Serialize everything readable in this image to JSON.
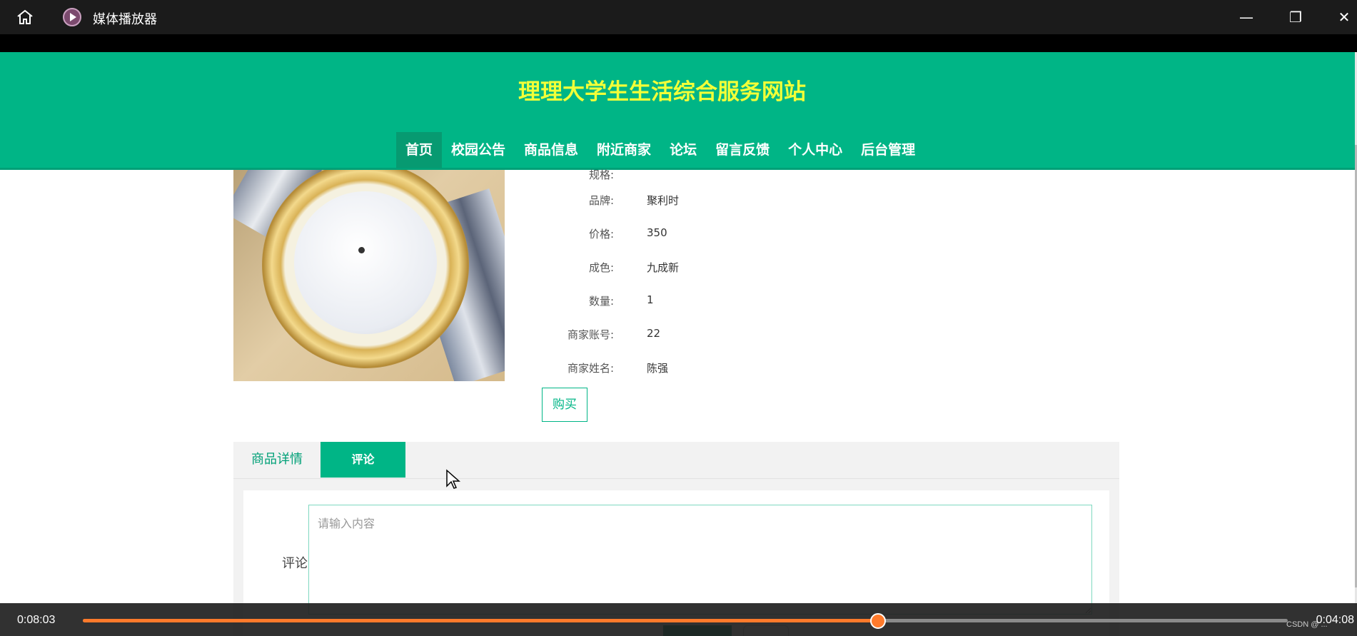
{
  "window": {
    "title": "媒体播放器",
    "icons": {
      "home": "home-icon",
      "app": "media-player-icon",
      "minimize": "minimize-icon",
      "maximize": "restore-icon",
      "close": "close-icon"
    }
  },
  "site": {
    "title": "理理大学生生活综合服务网站",
    "colors": {
      "header": "#00b586",
      "title": "#f2ff38",
      "active_nav": "#079a71"
    },
    "nav": [
      {
        "label": "首页",
        "active": true
      },
      {
        "label": "校园公告"
      },
      {
        "label": "商品信息"
      },
      {
        "label": "附近商家"
      },
      {
        "label": "论坛"
      },
      {
        "label": "留言反馈"
      },
      {
        "label": "个人中心"
      },
      {
        "label": "后台管理"
      }
    ]
  },
  "product": {
    "specs": [
      {
        "label": "规格:",
        "value": ""
      },
      {
        "label": "品牌:",
        "value": "聚利时"
      },
      {
        "label": "价格:",
        "value": "350"
      },
      {
        "label": "成色:",
        "value": "九成新"
      },
      {
        "label": "数量:",
        "value": "1"
      },
      {
        "label": "商家账号:",
        "value": "22"
      },
      {
        "label": "商家姓名:",
        "value": "陈强"
      }
    ],
    "buy_label": "购买"
  },
  "tabs": [
    {
      "label": "商品详情"
    },
    {
      "label": "评论",
      "active": true
    }
  ],
  "comment": {
    "label": "评论",
    "placeholder": "请输入内容"
  },
  "player": {
    "current_time": "0:08:03",
    "remaining_time": "0:04:08",
    "progress": 0.66,
    "accent": "#ff7a2b",
    "watermark": "CSDN @ ..."
  }
}
